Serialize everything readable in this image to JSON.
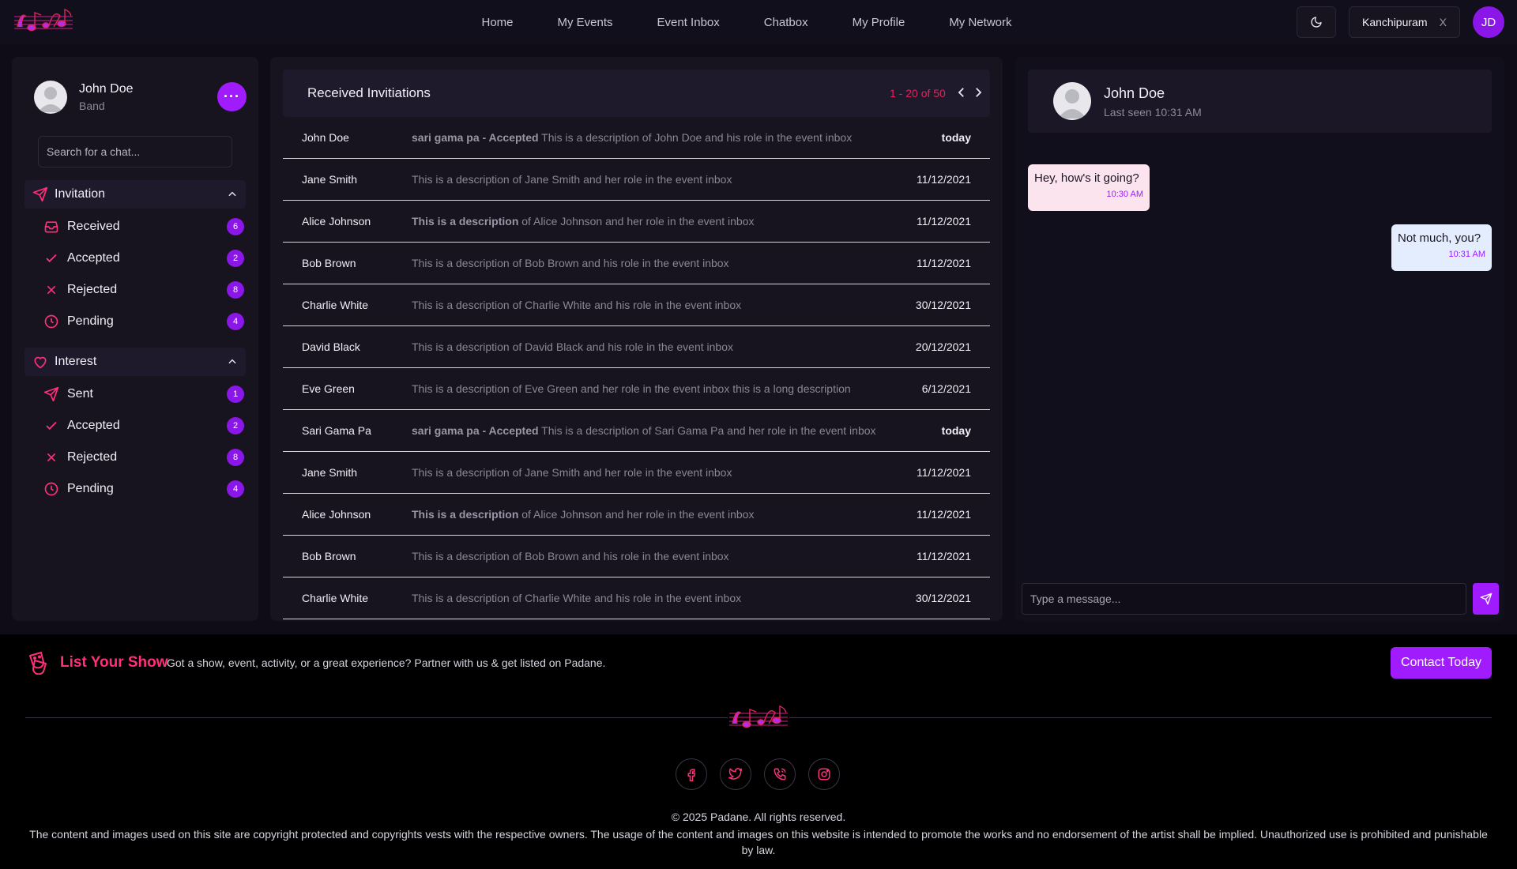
{
  "nav": {
    "items": [
      "Home",
      "My Events",
      "Event Inbox",
      "Chatbox",
      "My Profile",
      "My Network"
    ],
    "location": "Kanchipuram",
    "location_clear": "X",
    "user_initials": "JD"
  },
  "sidebar": {
    "profile": {
      "name": "John Doe",
      "role": "Band",
      "more_label": "···"
    },
    "search_placeholder": "Search for a chat...",
    "invitation": {
      "title": "Invitation",
      "items": [
        {
          "label": "Received",
          "count": "6",
          "icon": "inbox-icon"
        },
        {
          "label": "Accepted",
          "count": "2",
          "icon": "check-icon"
        },
        {
          "label": "Rejected",
          "count": "8",
          "icon": "x-icon"
        },
        {
          "label": "Pending",
          "count": "4",
          "icon": "clock-icon"
        }
      ]
    },
    "interest": {
      "title": "Interest",
      "items": [
        {
          "label": "Sent",
          "count": "1",
          "icon": "send-icon"
        },
        {
          "label": "Accepted",
          "count": "2",
          "icon": "check-icon"
        },
        {
          "label": "Rejected",
          "count": "8",
          "icon": "x-icon"
        },
        {
          "label": "Pending",
          "count": "4",
          "icon": "clock-icon"
        }
      ]
    }
  },
  "inbox": {
    "title": "Received Invitiations",
    "pager": "1 - 20 of 50",
    "rows": [
      {
        "name": "John Doe",
        "bold": "sari gama pa - Accepted",
        "desc": " This is a description of John Doe and his role in the event inbox",
        "date": "today"
      },
      {
        "name": "Jane Smith",
        "bold": "",
        "desc": "This is a description of Jane Smith and her role in the event inbox",
        "date": "11/12/2021"
      },
      {
        "name": "Alice Johnson",
        "bold": "This is a description",
        "desc": " of Alice Johnson and her role in the event inbox",
        "date": "11/12/2021"
      },
      {
        "name": "Bob Brown",
        "bold": "",
        "desc": "This is a description of Bob Brown and his role in the event inbox",
        "date": "11/12/2021"
      },
      {
        "name": "Charlie White",
        "bold": "",
        "desc": "This is a description of Charlie White and his role in the event inbox",
        "date": "30/12/2021"
      },
      {
        "name": "David Black",
        "bold": "",
        "desc": "This is a description of David Black and his role in the event inbox",
        "date": "20/12/2021"
      },
      {
        "name": "Eve Green",
        "bold": "",
        "desc": "This is a description of Eve Green and her role in the event inbox this is a long description",
        "date": "6/12/2021"
      },
      {
        "name": "Sari Gama Pa",
        "bold": "sari gama pa - Accepted",
        "desc": " This is a description of Sari Gama Pa and her role in the event inbox",
        "date": "today"
      },
      {
        "name": "Jane Smith",
        "bold": "",
        "desc": "This is a description of Jane Smith and her role in the event inbox",
        "date": "11/12/2021"
      },
      {
        "name": "Alice Johnson",
        "bold": "This is a description",
        "desc": " of Alice Johnson and her role in the event inbox",
        "date": "11/12/2021"
      },
      {
        "name": "Bob Brown",
        "bold": "",
        "desc": "This is a description of Bob Brown and his role in the event inbox",
        "date": "11/12/2021"
      },
      {
        "name": "Charlie White",
        "bold": "",
        "desc": "This is a description of Charlie White and his role in the event inbox",
        "date": "30/12/2021"
      }
    ]
  },
  "chat": {
    "name": "John Doe",
    "last_seen": "Last seen 10:31 AM",
    "messages": [
      {
        "text": "Hey, how's it going?",
        "time": "10:30 AM"
      },
      {
        "text": "Not much, you?",
        "time": "10:31 AM"
      }
    ],
    "input_placeholder": "Type a message..."
  },
  "footer": {
    "list_title": "List Your Show",
    "list_sub": "Got a show, event, activity, or a great experience? Partner with us & get listed on Padane.",
    "contact_label": "Contact Today",
    "social": [
      "facebook-icon",
      "twitter-icon",
      "phone-icon",
      "instagram-icon"
    ],
    "copyright": "© 2025 Padane. All rights reserved.",
    "disclaimer": "The content and images used on this site are copyright protected and copyrights vests with the respective owners. The usage of the content and images on this website is intended to promote the works and no endorsement of the artist shall be implied. Unauthorized use is prohibited and punishable by law."
  },
  "colors": {
    "accent": "#a11bff",
    "pink": "#ff2f7a",
    "badge": "#8a16e8"
  }
}
